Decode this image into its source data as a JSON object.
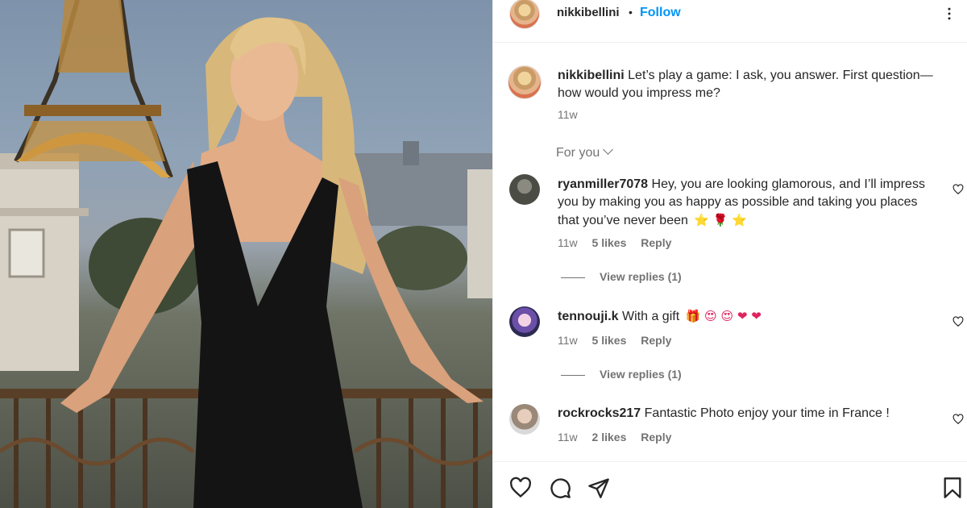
{
  "post": {
    "username": "nikkibellini",
    "separator": "•",
    "follow_label": "Follow",
    "caption_text": "Let’s play a game: I ask, you answer. First question—how would you impress me?",
    "caption_age": "11w",
    "filter_label": "For you"
  },
  "comments": [
    {
      "username": "ryanmiller7078",
      "text": "Hey, you are looking glamorous, and I’ll impress you by making you as happy as possible and taking you places that you’ve never been",
      "emoji": "⭐ 🌹 ⭐",
      "age": "11w",
      "likes": "5 likes",
      "reply_label": "Reply",
      "view_replies": "View replies (1)"
    },
    {
      "username": "tennouji.k",
      "text": "With a gift",
      "emoji": "🎁 😍 😍 ❤ ❤",
      "age": "11w",
      "likes": "5 likes",
      "reply_label": "Reply",
      "view_replies": "View replies (1)"
    },
    {
      "username": "rockrocks217",
      "text": "Fantastic Photo enjoy your time in France !",
      "emoji": "",
      "age": "11w",
      "likes": "2 likes",
      "reply_label": "Reply",
      "view_replies": ""
    }
  ],
  "icons": {
    "like": "heart-icon",
    "comment": "comment-icon",
    "share": "send-icon",
    "save": "bookmark-icon",
    "more": "more-options-icon"
  },
  "colors": {
    "accent": "#0095f6",
    "muted": "#737373",
    "text": "#262626",
    "emoji_heart": "#e0245e"
  }
}
